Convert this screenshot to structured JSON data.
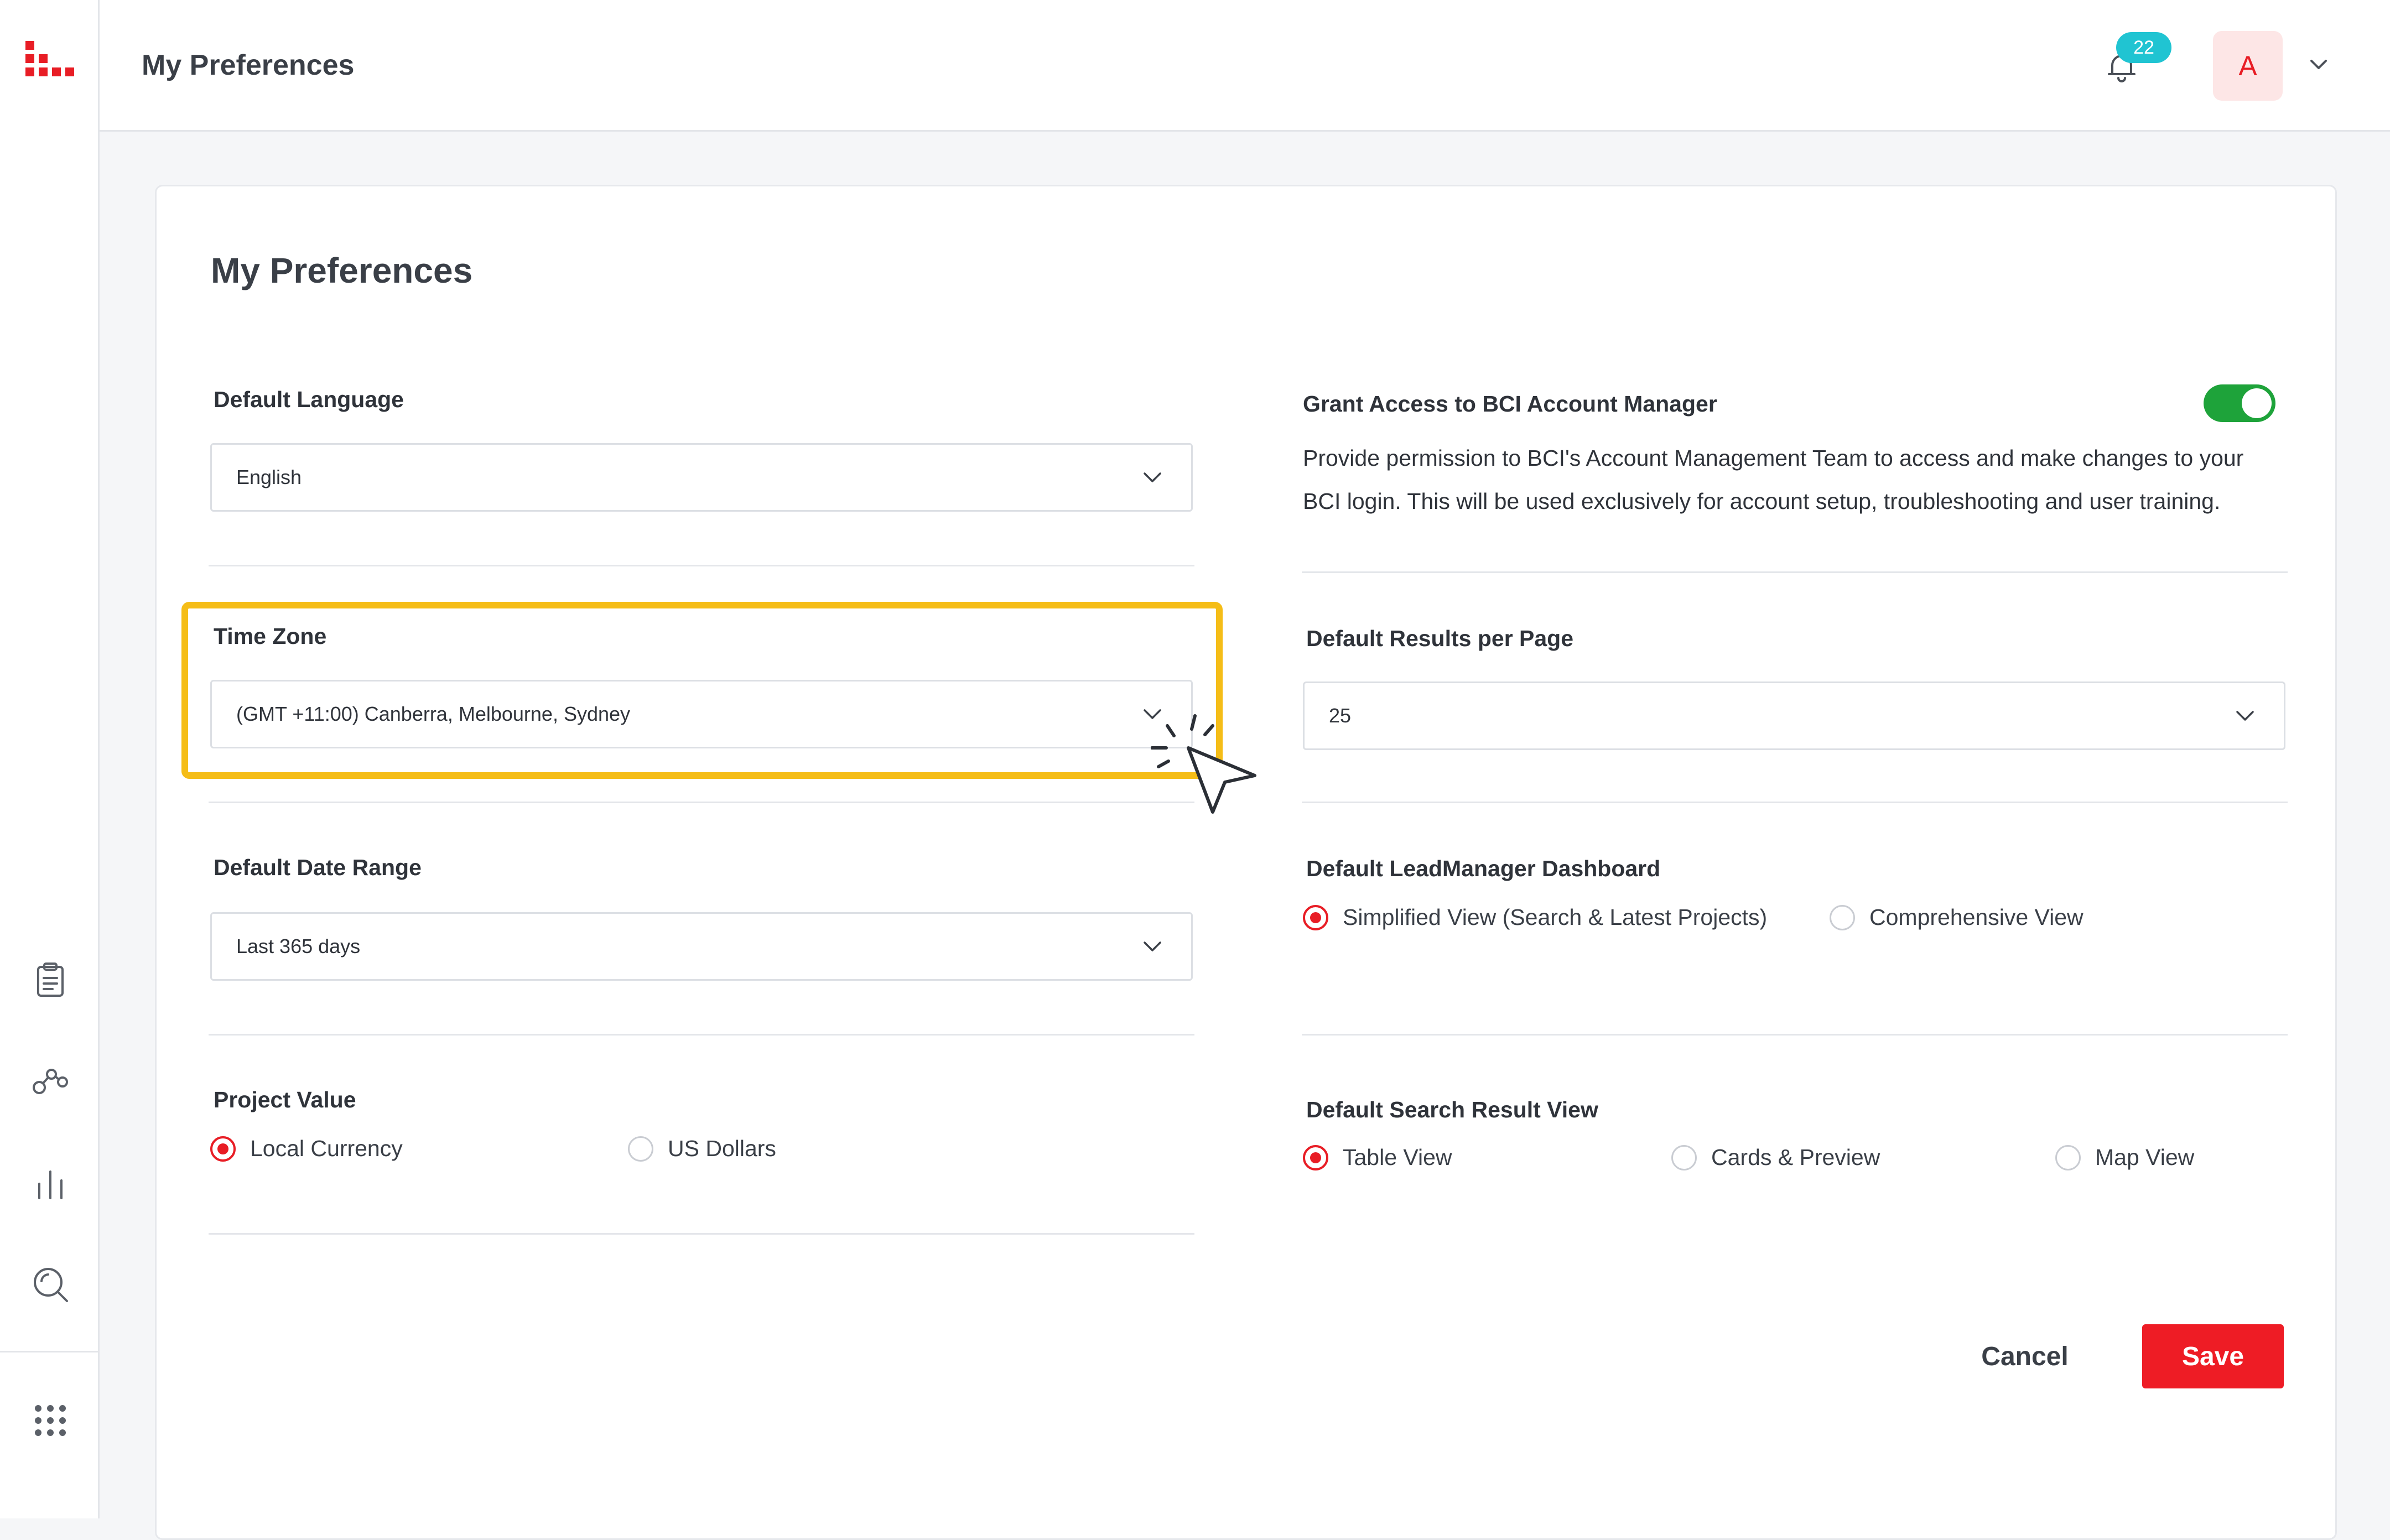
{
  "header": {
    "title": "My Preferences",
    "notification_count": "22",
    "avatar_initial": "A"
  },
  "sidebar": {
    "icons": [
      "logo-icon",
      "clipboard-icon",
      "network-icon",
      "bar-chart-icon",
      "search-icon",
      "apps-grid-icon"
    ]
  },
  "card": {
    "title": "My Preferences"
  },
  "language": {
    "label": "Default Language",
    "value": "English"
  },
  "timezone": {
    "label": "Time Zone",
    "value": "(GMT +11:00) Canberra, Melbourne, Sydney"
  },
  "date_range": {
    "label": "Default Date Range",
    "value": "Last 365 days"
  },
  "project_value": {
    "label": "Project Value",
    "options": [
      "Local Currency",
      "US Dollars"
    ],
    "selected": "Local Currency"
  },
  "grant_access": {
    "label": "Grant Access to BCI Account Manager",
    "enabled": true,
    "description": "Provide permission to BCI's Account Management Team to access and make changes to your BCI login. This will be used exclusively for account setup, troubleshooting and user training."
  },
  "results_per_page": {
    "label": "Default Results per Page",
    "value": "25"
  },
  "dashboard": {
    "label": "Default LeadManager Dashboard",
    "options": [
      "Simplified View (Search & Latest Projects)",
      "Comprehensive View"
    ],
    "selected": "Simplified View (Search & Latest Projects)"
  },
  "search_view": {
    "label": "Default Search Result View",
    "options": [
      "Table View",
      "Cards & Preview",
      "Map View"
    ],
    "selected": "Table View"
  },
  "actions": {
    "cancel_label": "Cancel",
    "save_label": "Save"
  },
  "colors": {
    "accent": "#e81d25",
    "toggle_on": "#1ea33a",
    "highlight": "#f5bd17",
    "badge": "#20c4d2"
  }
}
